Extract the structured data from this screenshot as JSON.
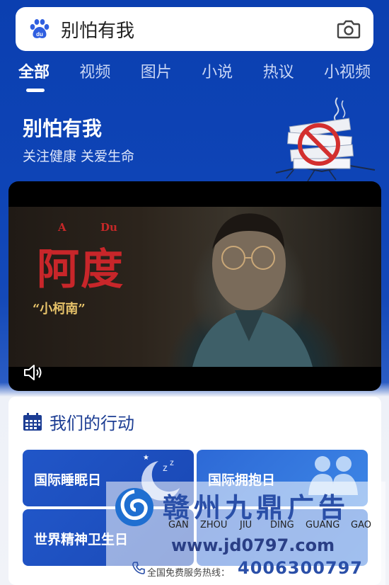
{
  "search": {
    "query": "别怕有我"
  },
  "tabs": [
    {
      "label": "全部",
      "active": true
    },
    {
      "label": "视频"
    },
    {
      "label": "图片"
    },
    {
      "label": "小说"
    },
    {
      "label": "热议"
    },
    {
      "label": "小视频"
    }
  ],
  "hero": {
    "title": "别怕有我",
    "subtitle": "关注健康 关爱生命"
  },
  "video": {
    "letter_a": "A",
    "letter_du": "Du",
    "title": "阿度",
    "quote": "“小柯南”"
  },
  "actions": {
    "title": "我们的行动",
    "items": [
      {
        "label": "国际睡眠日"
      },
      {
        "label": "国际拥抱日"
      },
      {
        "label": "世界精神卫生日"
      }
    ]
  },
  "watermark": {
    "name": "赣州九鼎广告",
    "pinyin": [
      "GAN",
      "ZHOU",
      "JIU",
      "DING",
      "GUANG",
      "GAO"
    ],
    "url": "www.jd0797.com",
    "hotline_label": "全国免费服务热线：",
    "phone": "4006300797"
  },
  "colors": {
    "primary_blue": "#0e44b6",
    "white": "#ffffff"
  }
}
